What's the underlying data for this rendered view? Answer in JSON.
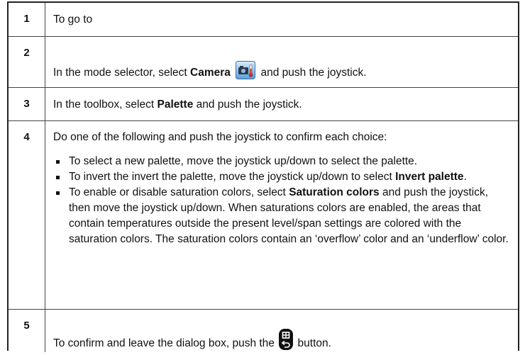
{
  "steps": [
    {
      "num": "1",
      "text": "To go to"
    },
    {
      "num": "2",
      "before": "In the mode selector, select ",
      "bold": "Camera",
      "after": " and push the joystick.",
      "icon": "camera-mode-icon"
    },
    {
      "num": "3",
      "before": "In the toolbox, select ",
      "bold": "Palette",
      "after": " and push the joystick."
    },
    {
      "num": "4",
      "intro": "Do one of the following and push the joystick to confirm each choice:",
      "bullets": [
        {
          "text": "To select a new palette, move the joystick up/down to select the palette."
        },
        {
          "before": "To invert the invert the palette, move the joystick up/down to select ",
          "bold": "Invert palette",
          "after": "."
        },
        {
          "before": "To enable or disable saturation colors, select ",
          "bold": "Saturation colors",
          "after": " and push the joystick, then move the joystick up/down. When saturations colors are enabled, the areas that contain temperatures outside the present level/span settings are colored with the saturation colors. The saturation colors contain an ‘overflow’ color and an ‘underflow’ color."
        }
      ]
    },
    {
      "num": "5",
      "before": "To confirm and leave the dialog box, push the ",
      "after": " button.",
      "icon": "back-button-icon"
    }
  ]
}
